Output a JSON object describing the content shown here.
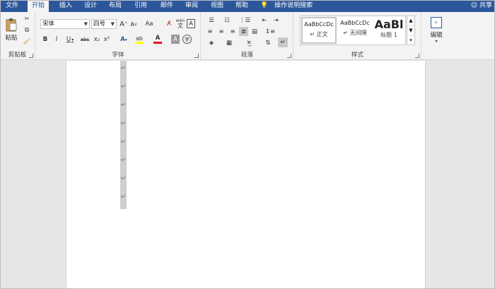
{
  "tabs": [
    "文件",
    "开始",
    "插入",
    "设计",
    "布局",
    "引用",
    "邮件",
    "审阅",
    "视图",
    "帮助"
  ],
  "active_tab": "开始",
  "tell_me": "操作说明搜索",
  "share": "共享",
  "clipboard": {
    "paste": "粘贴",
    "group": "剪贴板"
  },
  "font": {
    "name": "宋体",
    "size": "四号",
    "group": "字体",
    "bold": "B",
    "italic": "I",
    "underline": "U",
    "strike": "abc",
    "sub": "x₂",
    "sup": "x²",
    "grow": "A",
    "shrink": "A",
    "case": "Aa",
    "pinyin": "wén",
    "border_char": "A",
    "shade_char": "A",
    "circle_char": "字"
  },
  "paragraph": {
    "group": "段落"
  },
  "styles": {
    "group": "样式",
    "items": [
      {
        "sample": "AaBbCcDc",
        "name": "正文"
      },
      {
        "sample": "AaBbCcDc",
        "name": "无间隔"
      },
      {
        "sample": "AaBl",
        "name": "标题 1"
      }
    ]
  },
  "editing": {
    "label": "编辑"
  },
  "colors": {
    "accent": "#2b579a",
    "font_color": "#e81123",
    "highlight": "#ffff00"
  }
}
